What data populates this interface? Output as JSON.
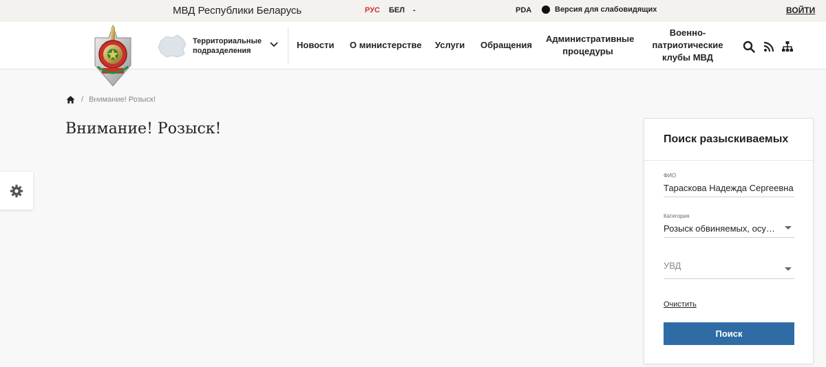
{
  "topbar": {
    "site_name": "МВД Республики Беларусь",
    "lang_ru": "РУС",
    "lang_be": "БЕЛ",
    "lang_dash": "-",
    "pda": "PDA",
    "vision": "Версия для слабовидящих",
    "login": "ВОЙТИ"
  },
  "header": {
    "territorial": "Территориальные подразделения",
    "nav": {
      "news": "Новости",
      "ministry": "О министерстве",
      "services": "Услуги",
      "appeals": "Обращения",
      "admin": "Административные процедуры",
      "clubs": "Военно-патриотические клубы МВД"
    },
    "icons": [
      "search-icon",
      "rss-icon",
      "sitemap-icon"
    ]
  },
  "breadcrumb": {
    "separator": "/",
    "current": "Внимание! Розыск!"
  },
  "page": {
    "title": "Внимание! Розыск!"
  },
  "search_panel": {
    "title": "Поиск разыскиваемых",
    "fio_label": "ФИО",
    "fio_value": "Тараскова Надежда Сергеевна",
    "category_label": "Категория",
    "category_value": "Розыск обвиняемых, осу…",
    "uvd_placeholder": "УВД",
    "clear": "Очистить",
    "search": "Поиск"
  },
  "colors": {
    "accent_red": "#d0312d",
    "button_blue": "#2f6ca6",
    "topbar_bg": "#f3f2ee"
  }
}
